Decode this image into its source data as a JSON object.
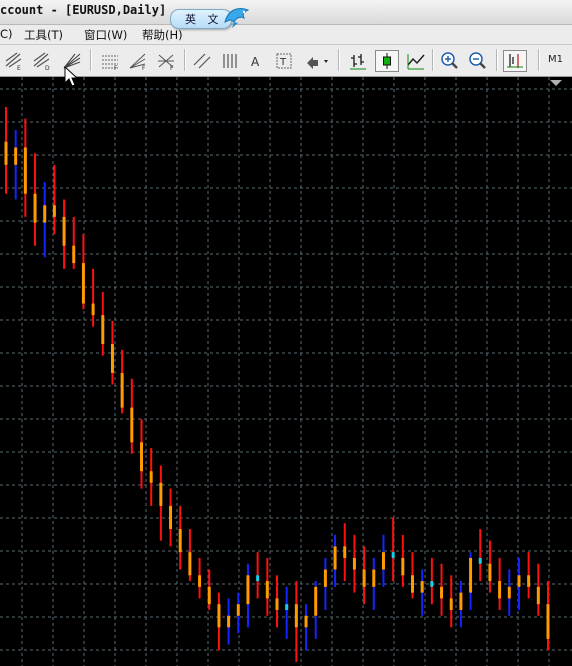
{
  "window": {
    "title": "ccount - [EURUSD,Daily]"
  },
  "ime": {
    "label": "英 文",
    "icon": "dolphin-icon"
  },
  "menu": {
    "items": [
      "C)",
      "工具(T)",
      "窗口(W)",
      "帮助(H)"
    ]
  },
  "toolbar": {
    "buttons": [
      "period-e-icon",
      "period-d-icon",
      "fan-lines-icon",
      "fibo-retracement-icon",
      "fibo-fan-icon",
      "fibo-arcs-icon",
      "parallel-channel-icon",
      "vertical-lines-icon",
      "text-a-icon",
      "text-label-icon",
      "arrow-shapes-dropdown-icon",
      "bar-chart-icon",
      "candlestick-chart-icon",
      "line-chart-icon",
      "zoom-in-icon",
      "zoom-out-icon",
      "chart-shift-icon"
    ],
    "period_label": "M1"
  },
  "chart_data": {
    "type": "candlestick",
    "symbol": "EURUSD",
    "timeframe": "Daily",
    "background": "#000000",
    "grid": "dashed",
    "grid_color": "#5b6a72",
    "colors": {
      "up": "#1424ff",
      "down": "#ff1010",
      "body": "#ff9a00",
      "doji": "#16d0e8"
    },
    "note": "No price or time axis is visible; values are relative price levels (higher = higher price).",
    "ohlc": [
      [
        84,
        90,
        75,
        80
      ],
      [
        80,
        86,
        74,
        83
      ],
      [
        83,
        88,
        71,
        75
      ],
      [
        75,
        82,
        66,
        70
      ],
      [
        70,
        77,
        64,
        73
      ],
      [
        73,
        80,
        68,
        71
      ],
      [
        71,
        74,
        62,
        66
      ],
      [
        66,
        71,
        62,
        63
      ],
      [
        63,
        68,
        55,
        56
      ],
      [
        56,
        62,
        52,
        54
      ],
      [
        54,
        58,
        47,
        49
      ],
      [
        49,
        53,
        42,
        44
      ],
      [
        44,
        48,
        37,
        38
      ],
      [
        38,
        43,
        30,
        32
      ],
      [
        32,
        36,
        24,
        27
      ],
      [
        27,
        31,
        21,
        25
      ],
      [
        25,
        28,
        15,
        21
      ],
      [
        21,
        24,
        14,
        17
      ],
      [
        17,
        21,
        10,
        13
      ],
      [
        13,
        17,
        8,
        9
      ],
      [
        9,
        12,
        5,
        7
      ],
      [
        7,
        10,
        3,
        4
      ],
      [
        4,
        6,
        -4,
        0
      ],
      [
        0,
        5,
        -3,
        2
      ],
      [
        2,
        6,
        -1,
        4
      ],
      [
        4,
        11,
        0,
        9
      ],
      [
        9,
        13,
        5,
        8
      ],
      [
        8,
        12,
        2,
        5
      ],
      [
        5,
        9,
        0,
        3
      ],
      [
        3,
        7,
        -2,
        4
      ],
      [
        4,
        8,
        -6,
        0
      ],
      [
        0,
        4,
        -4,
        2
      ],
      [
        2,
        8,
        -2,
        7
      ],
      [
        7,
        12,
        3,
        10
      ],
      [
        10,
        16,
        7,
        14
      ],
      [
        14,
        18,
        8,
        12
      ],
      [
        12,
        16,
        6,
        10
      ],
      [
        10,
        14,
        4,
        7
      ],
      [
        7,
        12,
        3,
        10
      ],
      [
        10,
        16,
        7,
        13
      ],
      [
        13,
        19,
        8,
        12
      ],
      [
        12,
        16,
        7,
        9
      ],
      [
        9,
        13,
        5,
        6
      ],
      [
        6,
        10,
        2,
        8
      ],
      [
        8,
        12,
        4,
        7
      ],
      [
        7,
        11,
        2,
        5
      ],
      [
        5,
        9,
        0,
        3
      ],
      [
        3,
        8,
        0,
        6
      ],
      [
        6,
        13,
        3,
        12
      ],
      [
        12,
        17,
        8,
        11
      ],
      [
        11,
        15,
        6,
        8
      ],
      [
        8,
        12,
        3,
        5
      ],
      [
        5,
        10,
        2,
        7
      ],
      [
        7,
        12,
        3,
        9
      ],
      [
        9,
        13,
        5,
        7
      ],
      [
        7,
        11,
        2,
        4
      ],
      [
        4,
        8,
        -4,
        -2
      ]
    ]
  }
}
